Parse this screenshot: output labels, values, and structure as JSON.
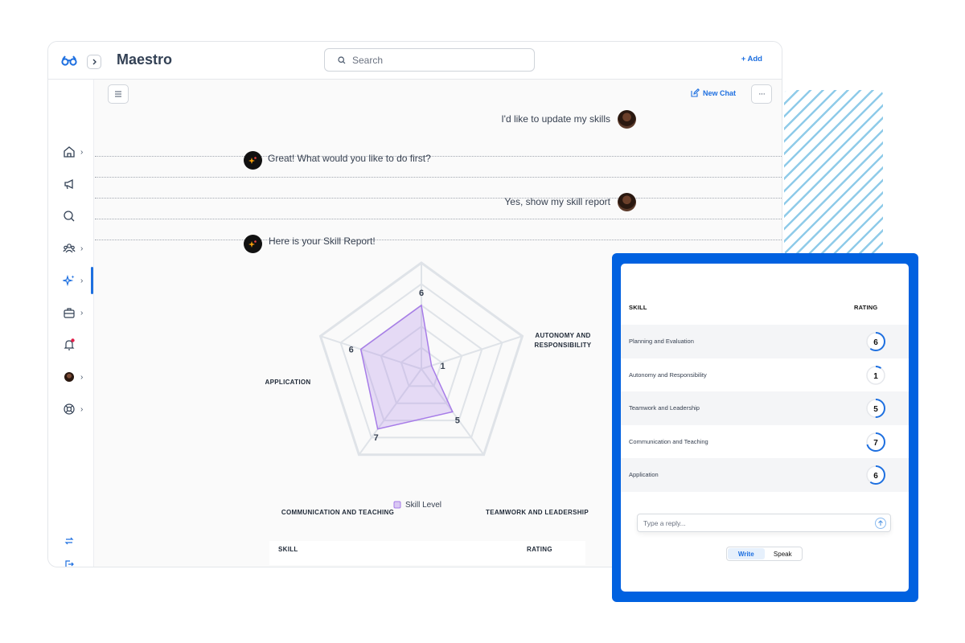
{
  "app": {
    "title": "Maestro"
  },
  "search": {
    "placeholder": "Search"
  },
  "header": {
    "add_label": "+ Add"
  },
  "toolbar": {
    "new_chat_label": "New Chat",
    "more_label": "···"
  },
  "chat": {
    "messages": [
      {
        "from": "user",
        "text": "I'd like to update my skills"
      },
      {
        "from": "bot",
        "text": "Great! What would you like to do first?"
      },
      {
        "from": "user",
        "text": "Yes, show my skill report"
      },
      {
        "from": "bot",
        "text": "Here is your Skill Report!"
      }
    ]
  },
  "chart_data": {
    "type": "radar",
    "axes": [
      "PLANNING AND EVALUATION",
      "AUTONOMY AND RESPONSIBILITY",
      "TEAMWORK AND LEADERSHIP",
      "COMMUNICATION AND TEACHING",
      "APPLICATION"
    ],
    "axis_label_lines": [
      [
        "PLANNING AND EVALUATION"
      ],
      [
        "AUTONOMY AND",
        "RESPONSIBILITY"
      ],
      [
        "TEAMWORK AND LEADERSHIP"
      ],
      [
        "COMMUNICATION AND TEACHING"
      ],
      [
        "APPLICATION"
      ]
    ],
    "series": [
      {
        "name": "Skill Level",
        "values": [
          6,
          1,
          5,
          7,
          6
        ],
        "color": "#a77ce8"
      }
    ],
    "max": 10,
    "rings": 5,
    "legend": "bottom"
  },
  "skills_table": {
    "headers": {
      "skill": "SKILL",
      "rating": "RATING"
    },
    "rows": [
      {
        "skill": "Planning and Evaluation",
        "rating": 6
      },
      {
        "skill": "Autonomy and Responsibility",
        "rating": 1
      },
      {
        "skill": "Teamwork and Leadership",
        "rating": 5
      },
      {
        "skill": "Communication and Teaching",
        "rating": 7
      },
      {
        "skill": "Application",
        "rating": 6
      }
    ],
    "rating_max": 10,
    "accent": "#1d6fe0"
  },
  "reply": {
    "placeholder": "Type a reply..."
  },
  "mode_toggle": {
    "write": "Write",
    "speak": "Speak",
    "selected": "Write"
  },
  "colors": {
    "brand": "#1d6fe0",
    "overlay_frame": "#0061e0",
    "radar_fill": "#a77ce8",
    "notification": "#e11d48"
  }
}
